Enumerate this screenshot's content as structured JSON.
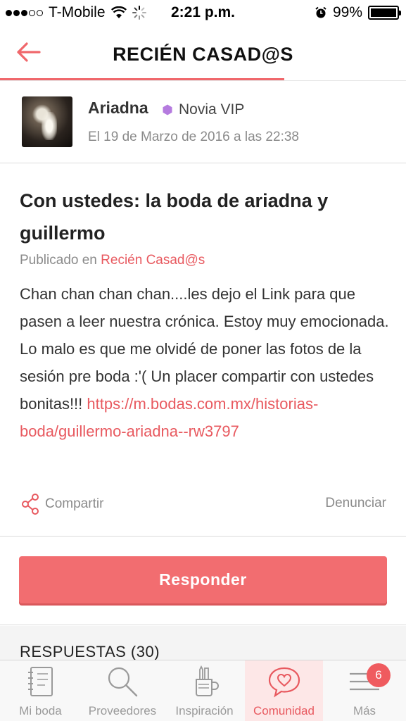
{
  "status_bar": {
    "carrier": "T-Mobile",
    "time": "2:21 p.m.",
    "battery": "99%",
    "battery_level": 0.99
  },
  "header": {
    "title": "RECIÉN CASAD@S",
    "scroll_progress": 0.7
  },
  "author": {
    "name": "Ariadna",
    "badge": "Novia VIP",
    "badge_color": "#b57bdf",
    "date": "El 19 de Marzo de 2016 a las 22:38"
  },
  "post": {
    "title": "Con ustedes: la boda de ariadna y guillermo",
    "published_prefix": "Publicado en",
    "published_category": "Recién Casad@s",
    "body": "Chan chan chan chan....les dejo el Link para que pasen a leer nuestra crónica. Estoy muy emocionada. Lo malo es que me olvidé de poner las fotos de la sesión pre boda :'( Un placer compartir con ustedes bonitas!!!",
    "link": "https://m.bodas.com.mx/historias-boda/guillermo-ariadna--rw3797",
    "share_label": "Compartir",
    "report_label": "Denunciar"
  },
  "reply": {
    "button_label": "Responder"
  },
  "replies": {
    "title": "RESPUESTAS (30)"
  },
  "tab_bar": {
    "tabs": [
      {
        "label": "Mi boda",
        "icon": "notebook-icon"
      },
      {
        "label": "Proveedores",
        "icon": "search-icon"
      },
      {
        "label": "Inspiración",
        "icon": "pencil-cup-icon"
      },
      {
        "label": "Comunidad",
        "icon": "chat-heart-icon",
        "active": true
      },
      {
        "label": "Más",
        "icon": "menu-icon",
        "badge": "6"
      }
    ]
  },
  "colors": {
    "accent": "#f26d70",
    "link": "#e8595f"
  }
}
